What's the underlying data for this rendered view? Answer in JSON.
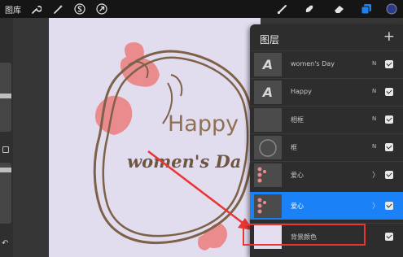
{
  "toolbar": {
    "gallery_label": "图库",
    "left_tools": [
      "wrench-icon",
      "magic-wand-icon",
      "selection-s-icon",
      "arrow-cursor-icon"
    ],
    "right_tools": [
      "brush-icon",
      "smudge-icon",
      "eraser-icon",
      "layers-icon",
      "color-swatch-icon"
    ]
  },
  "canvas": {
    "background_color": "#e2dcef",
    "text_happy": "Happy",
    "text_womens": "women's Da"
  },
  "layers_panel": {
    "title": "图层",
    "add_icon": "+",
    "layers": [
      {
        "name": "women's Day",
        "blend": "N",
        "visible": true
      },
      {
        "name": "Happy",
        "blend": "N",
        "visible": true
      },
      {
        "name": "相框",
        "blend": "N",
        "visible": true
      },
      {
        "name": "框",
        "blend": "N",
        "visible": true
      },
      {
        "name": "爱心",
        "blend": "",
        "visible": true,
        "group": true
      },
      {
        "name": "爱心",
        "blend": "",
        "visible": true,
        "group": true,
        "active": true
      },
      {
        "name": "背景颜色",
        "blend": "",
        "visible": true
      }
    ],
    "active_color": "#1a82f6"
  },
  "annotation": {
    "color": "#ea3535"
  }
}
